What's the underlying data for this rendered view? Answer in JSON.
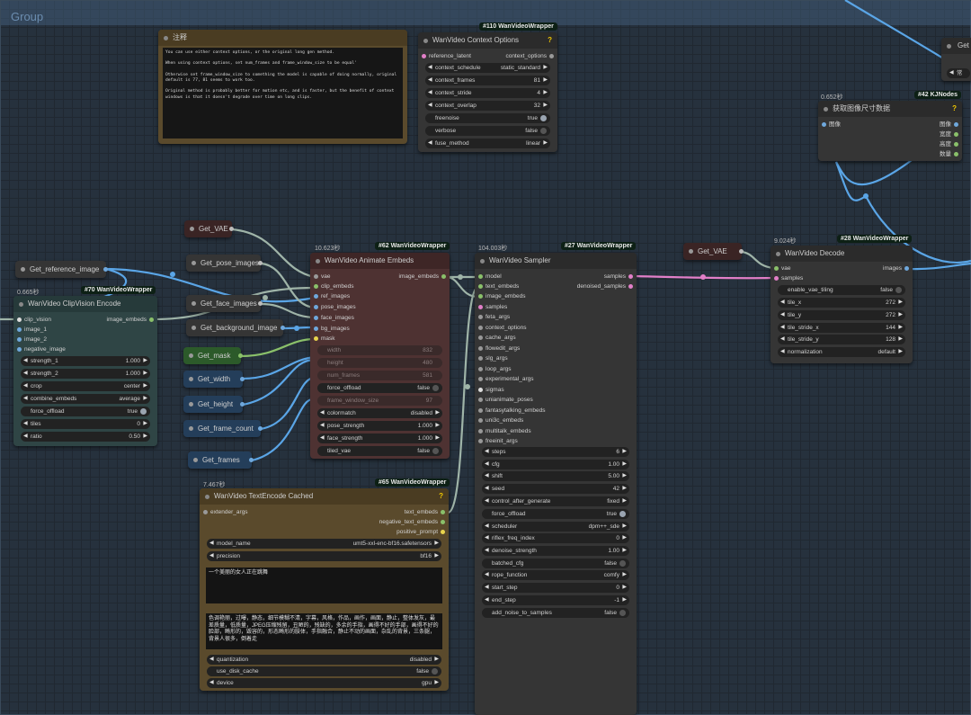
{
  "group": {
    "title": "Group"
  },
  "note": {
    "title": "注释",
    "text": "You can use either context options, or the original long gen method.\n\nWhen using context options, set num_frames and frame_window_size to be equal'\n\nOtherwise set frame_window_size to something the model is capable of doing normally, original default is 77, 81 seems to work too.\n\nOriginal method is probably better for motion etc, and is faster, but the benefit of context windows is that it doesn't degrade over time on long clips."
  },
  "ctx": {
    "badge": "#110 WanVideoWrapper",
    "title": "WanVideo Context Options",
    "help": "?",
    "in": "reference_latent",
    "out": "context_options",
    "widgets": [
      [
        "context_schedule",
        "static_standard"
      ],
      [
        "context_frames",
        "81"
      ],
      [
        "context_stride",
        "4"
      ],
      [
        "context_overlap",
        "32"
      ]
    ],
    "freenoise": [
      "freenoise",
      "true"
    ],
    "verbose": [
      "verbose",
      "false"
    ],
    "fuse": [
      "fuse_method",
      "linear"
    ]
  },
  "imgsize": {
    "timer": "0.652秒",
    "badge": "#42 KJNodes",
    "title": "获取图像尺寸数据",
    "help": "?",
    "in": "图像",
    "outs": [
      "图像",
      "宽度",
      "高度",
      "数量"
    ]
  },
  "getpartial": {
    "label": "Get",
    "sub": "常"
  },
  "gets": {
    "vae1": "Get_VAE",
    "pose": "Get_pose_images",
    "ref": "Get_reference_image",
    "face": "Get_face_images",
    "bg": "Get_background_image",
    "mask": "Get_mask",
    "width": "Get_width",
    "height": "Get_height",
    "frame_count": "Get_frame_count",
    "frames": "Get_frames",
    "vae2": "Get_VAE"
  },
  "clipvis": {
    "timer": "0.665秒",
    "badge": "#70 WanVideoWrapper",
    "title": "WanVideo ClipVision Encode",
    "ins": [
      "clip_vision",
      "image_1",
      "image_2",
      "negative_image"
    ],
    "out": "image_embeds",
    "widgets": [
      [
        "strength_1",
        "1.000"
      ],
      [
        "strength_2",
        "1.000"
      ],
      [
        "crop",
        "center"
      ],
      [
        "combine_embeds",
        "average"
      ]
    ],
    "force_offload": [
      "force_offload",
      "true"
    ],
    "tiles": [
      "tiles",
      "0"
    ],
    "ratio": [
      "ratio",
      "0.50"
    ]
  },
  "animate": {
    "timer": "10.623秒",
    "badge": "#62 WanVideoWrapper",
    "title": "WanVideo Animate Embeds",
    "ins": [
      "vae",
      "clip_embeds",
      "ref_images",
      "pose_images",
      "face_images",
      "bg_images",
      "mask"
    ],
    "out": "image_embeds",
    "disabled": [
      [
        "width",
        "832"
      ],
      [
        "height",
        "480"
      ],
      [
        "num_frames",
        "581"
      ]
    ],
    "force_offload": [
      "force_offload",
      "false"
    ],
    "frame_window_size": [
      "frame_window_size",
      "97"
    ],
    "widgets": [
      [
        "colormatch",
        "disabled"
      ],
      [
        "pose_strength",
        "1.000"
      ],
      [
        "face_strength",
        "1.000"
      ]
    ],
    "tiled_vae": [
      "tiled_vae",
      "false"
    ]
  },
  "sampler": {
    "timer": "104.003秒",
    "badge": "#27 WanVideoWrapper",
    "title": "WanVideo Sampler",
    "ins": [
      "model",
      "text_embeds",
      "image_embeds",
      "samples",
      "feta_args",
      "context_options",
      "cache_args",
      "flowedit_args",
      "slg_args",
      "loop_args",
      "experimental_args",
      "sigmas",
      "unianimate_poses",
      "fantasytalking_embeds",
      "uni3c_embeds",
      "multitalk_embeds",
      "freeinit_args"
    ],
    "outs": [
      "samples",
      "denoised_samples"
    ],
    "widgets": [
      [
        "steps",
        "6"
      ],
      [
        "cfg",
        "1.00"
      ],
      [
        "shift",
        "5.00"
      ],
      [
        "seed",
        "42"
      ],
      [
        "control_after_generate",
        "fixed"
      ],
      [
        "force_offload",
        "true"
      ],
      [
        "scheduler",
        "dpm++_sde"
      ],
      [
        "riflex_freq_index",
        "0"
      ],
      [
        "denoise_strength",
        "1.00"
      ],
      [
        "batched_cfg",
        "false"
      ],
      [
        "rope_function",
        "comfy"
      ],
      [
        "start_step",
        "0"
      ],
      [
        "end_step",
        "-1"
      ],
      [
        "add_noise_to_samples",
        "false"
      ]
    ]
  },
  "decode": {
    "timer": "9.024秒",
    "badge": "#28 WanVideoWrapper",
    "title": "WanVideo Decode",
    "ins": [
      "vae",
      "samples"
    ],
    "out": "images",
    "widgets": [
      [
        "enable_vae_tiling",
        "false"
      ],
      [
        "tile_x",
        "272"
      ],
      [
        "tile_y",
        "272"
      ],
      [
        "tile_stride_x",
        "144"
      ],
      [
        "tile_stride_y",
        "128"
      ],
      [
        "normalization",
        "default"
      ]
    ]
  },
  "textenc": {
    "timer": "7.467秒",
    "badge": "#65 WanVideoWrapper",
    "title": "WanVideo TextEncode Cached",
    "help": "?",
    "in": "extender_args",
    "outs": [
      "text_embeds",
      "negative_text_embeds",
      "positive_prompt"
    ],
    "model": [
      "model_name",
      "umt5-xxl-enc-bf16.safetensors"
    ],
    "precision": [
      "precision",
      "bf16"
    ],
    "prompt": "一个美丽的女人正在跳舞",
    "negative": "色调艳丽，过曝，静态，细节模糊不清，字幕，风格，作品，画作，画面，静止，整体发灰，最差质量，低质量，JPEG压缩残留，丑陋的，残缺的，多余的手指，画得不好的手部，画得不好的脸部，畸形的，毁容的，形态畸形的肢体，手指融合，静止不动的画面，杂乱的背景，三条腿，背景人很多，倒着走",
    "quantization": [
      "quantization",
      "disabled"
    ],
    "use_disk_cache": [
      "use_disk_cache",
      "false"
    ],
    "device": [
      "device",
      "gpu"
    ]
  }
}
